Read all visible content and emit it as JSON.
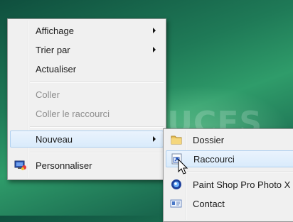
{
  "watermark": "PCASTUCES",
  "main_menu": {
    "affichage": "Affichage",
    "trier_par": "Trier par",
    "actualiser": "Actualiser",
    "coller": "Coller",
    "coller_raccourci": "Coller le raccourci",
    "nouveau": "Nouveau",
    "personnaliser": "Personnaliser"
  },
  "sub_menu": {
    "dossier": "Dossier",
    "raccourci": "Raccourci",
    "paint_shop": "Paint Shop Pro Photo X",
    "contact": "Contact"
  },
  "icons": {
    "personnaliser": "display-properties-icon",
    "dossier": "folder-icon",
    "raccourci": "shortcut-icon",
    "paint_shop": "paint-shop-pro-icon",
    "contact": "contact-card-icon"
  }
}
